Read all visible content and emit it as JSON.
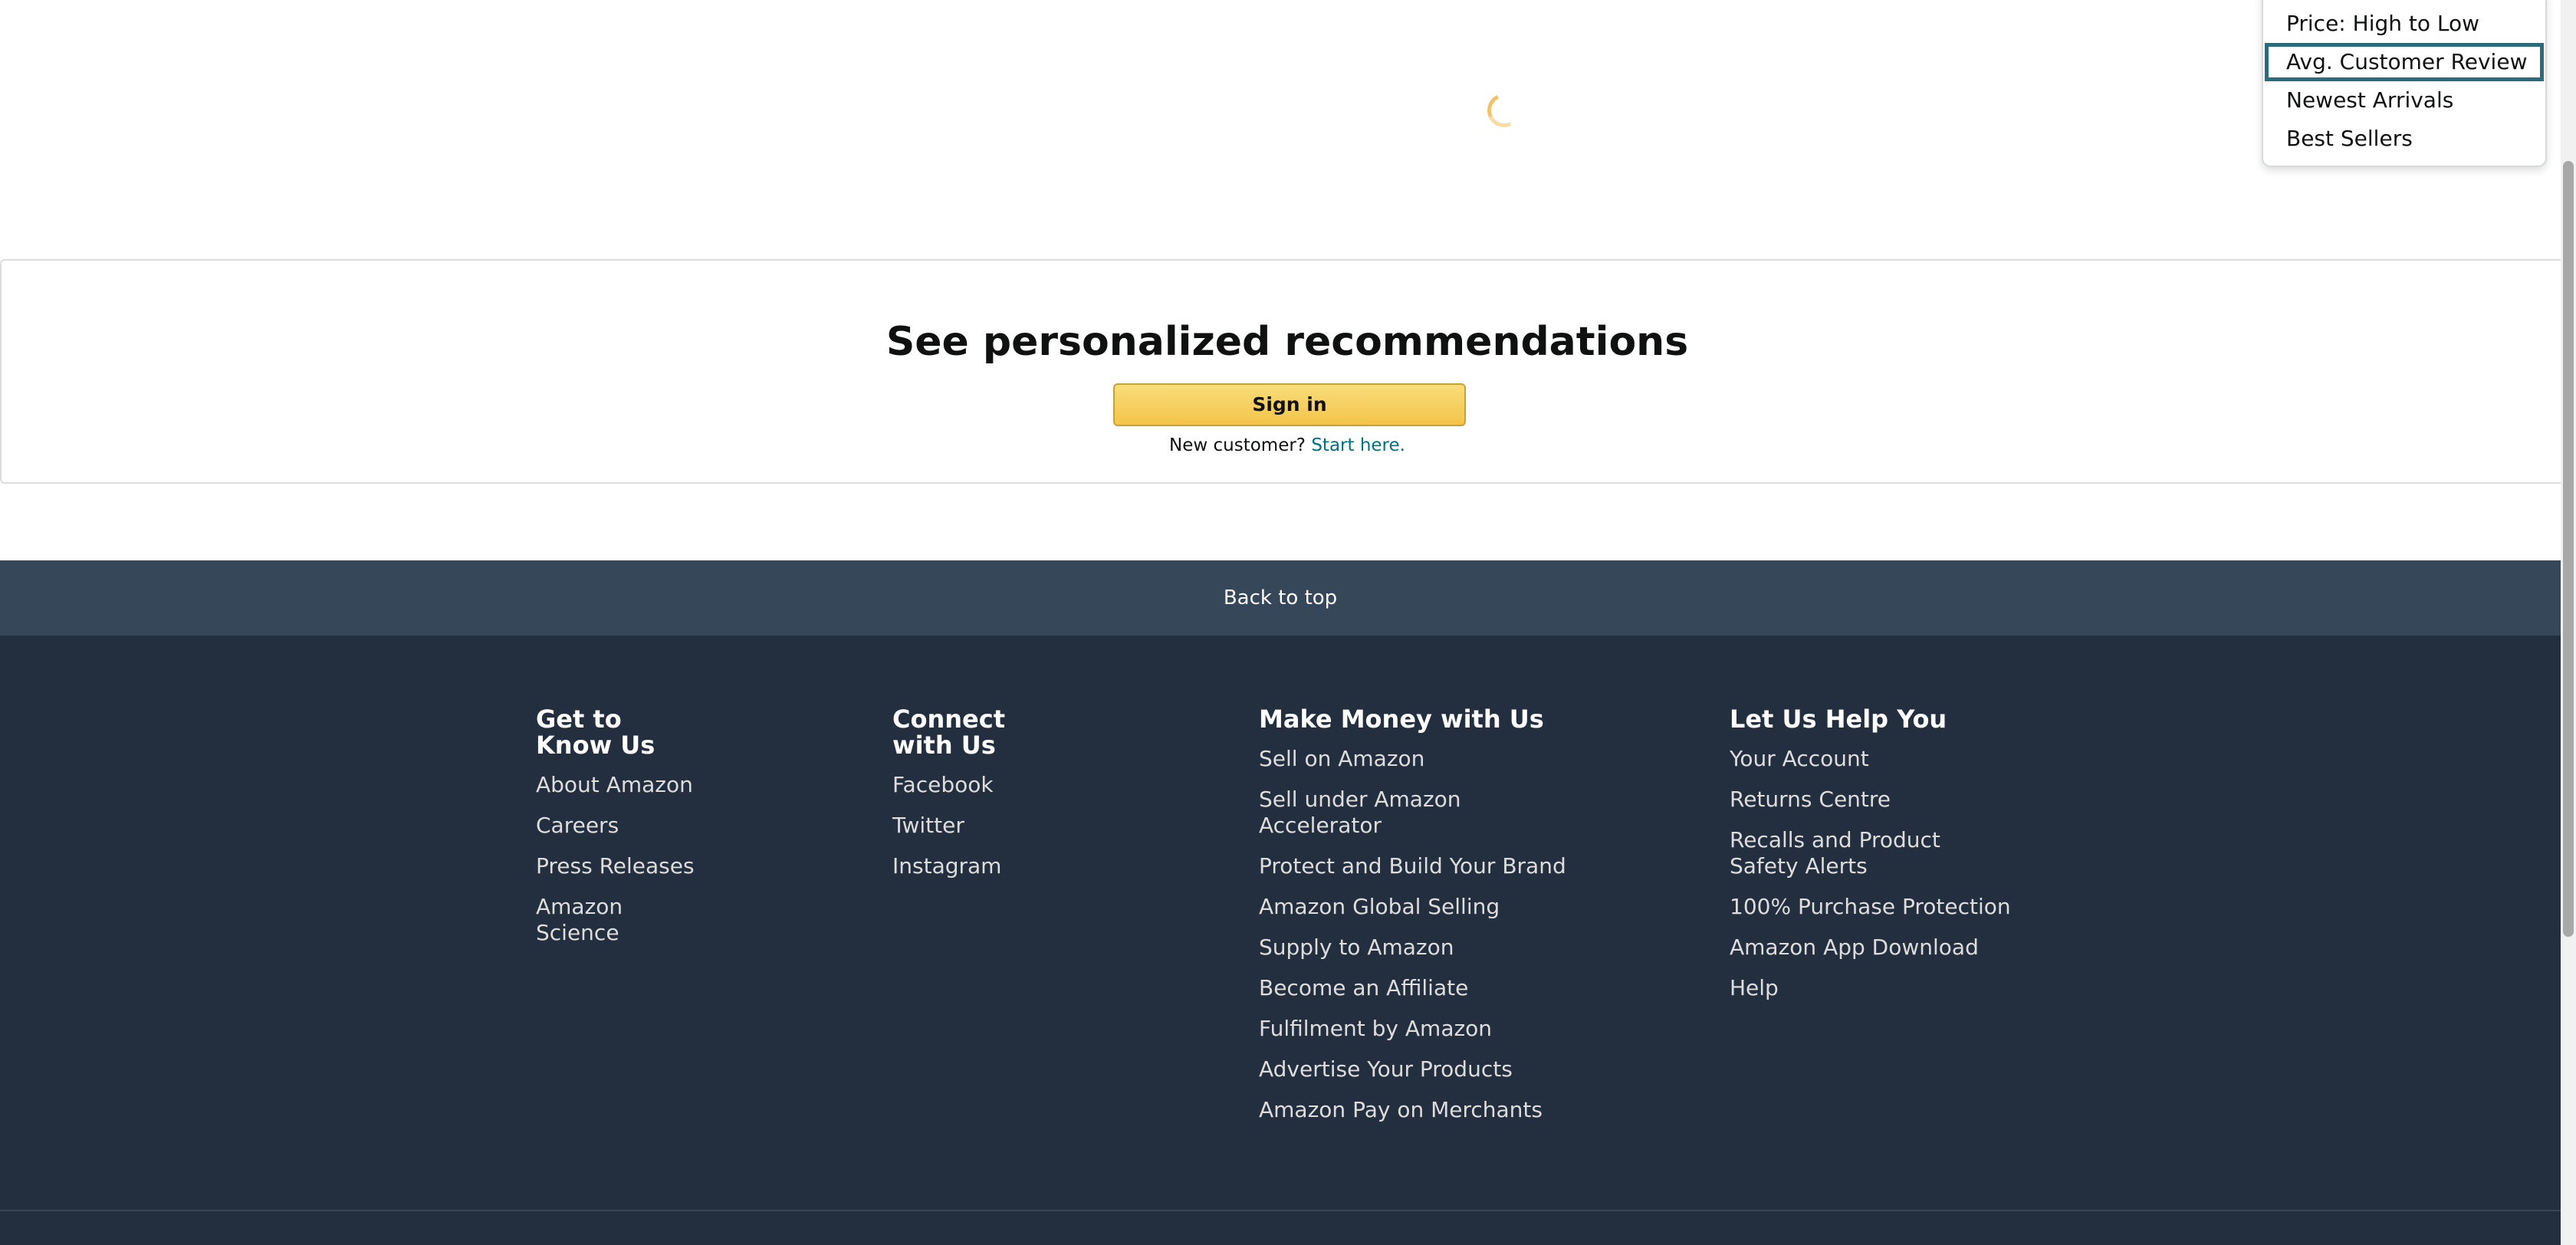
{
  "sort_dropdown": {
    "options": [
      {
        "label": "Price: High to Low"
      },
      {
        "label": "Avg. Customer Review",
        "focused": true
      },
      {
        "label": "Newest Arrivals"
      },
      {
        "label": "Best Sellers"
      }
    ]
  },
  "recommendations": {
    "title": "See personalized recommendations",
    "signin_label": "Sign in",
    "new_customer_text": "New customer?",
    "start_here_label": "Start here."
  },
  "back_to_top": "Back to top",
  "footer": {
    "columns": [
      {
        "heading": "Get to Know Us",
        "links": [
          "About Amazon",
          "Careers",
          "Press Releases",
          "Amazon Science"
        ]
      },
      {
        "heading": "Connect with Us",
        "links": [
          "Facebook",
          "Twitter",
          "Instagram"
        ]
      },
      {
        "heading": "Make Money with Us",
        "links": [
          "Sell on Amazon",
          "Sell under Amazon Accelerator",
          "Protect and Build Your Brand",
          "Amazon Global Selling",
          "Supply to Amazon",
          "Become an Affiliate",
          "Fulfilment by Amazon",
          "Advertise Your Products",
          "Amazon Pay on Merchants"
        ]
      },
      {
        "heading": "Let Us Help You",
        "links": [
          "Your Account",
          "Returns Centre",
          "Recalls and Product Safety Alerts",
          "100% Purchase Protection",
          "Amazon App Download",
          "Help"
        ]
      }
    ]
  },
  "colors": {
    "footer_bg": "#232f3e",
    "back_to_top_bg": "#37475a",
    "signin_button": "#f4c44a",
    "link_teal": "#007185",
    "focus_outline": "#2b6b7c"
  }
}
